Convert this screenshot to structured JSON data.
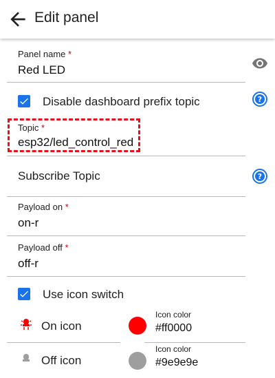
{
  "header": {
    "title": "Edit panel",
    "back_icon": "arrow-back-icon"
  },
  "form": {
    "panel_name": {
      "label": "Panel name",
      "required": "*",
      "value": "Red LED"
    },
    "disable_prefix": {
      "label": "Disable dashboard prefix topic",
      "checked": true
    },
    "topic": {
      "label": "Topic",
      "required": "*",
      "value": "esp32/led_control_red"
    },
    "subscribe_topic": {
      "placeholder": "Subscribe Topic"
    },
    "payload_on": {
      "label": "Payload on",
      "required": "*",
      "value": "on-r"
    },
    "payload_off": {
      "label": "Payload off",
      "required": "*",
      "value": "off-r"
    },
    "use_icon_switch": {
      "label": "Use icon switch",
      "checked": true
    },
    "on_icon": {
      "label": "On icon",
      "icon": "led-icon",
      "icon_color_label": "Icon color",
      "color": "#ff0000",
      "color_text": "#ff0000"
    },
    "off_icon": {
      "label": "Off icon",
      "icon": "bulb-icon",
      "icon_color_label": "Icon color",
      "color": "#9e9e9e",
      "color_text": "#9e9e9e"
    }
  },
  "colors": {
    "accent": "#1a73e8",
    "highlight": "#e3101e",
    "required": "#d50000"
  }
}
